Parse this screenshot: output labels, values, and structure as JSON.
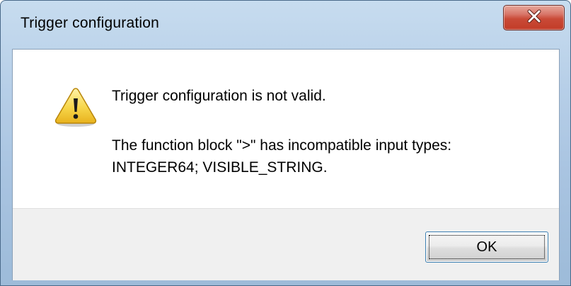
{
  "window": {
    "title": "Trigger configuration"
  },
  "titlebar": {
    "close_icon": "close-x-icon",
    "close_color": "#c94a37"
  },
  "message": {
    "icon": "warning-icon",
    "main": "Trigger configuration is not valid.",
    "detail_line1": "The function block \">\" has incompatible input types:",
    "detail_line2": "INTEGER64; VISIBLE_STRING."
  },
  "buttons": {
    "ok_label": "OK"
  }
}
